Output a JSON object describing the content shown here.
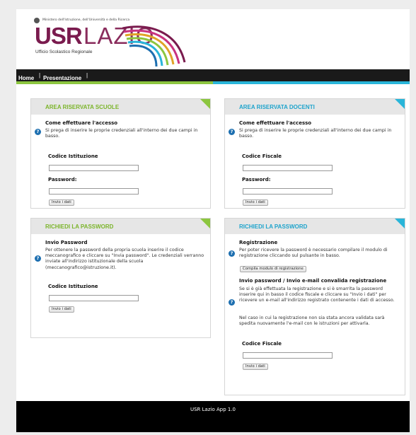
{
  "header": {
    "ministry": "Ministero dell'Istruzione, dell'Università e della Ricerca",
    "logo_bold": "USR",
    "logo_light": "LAZIO",
    "logo_sub": "Ufficio Scolastico Regionale"
  },
  "nav": {
    "items": [
      {
        "label": "Home"
      },
      {
        "label": "Presentazione"
      }
    ],
    "separator": "|"
  },
  "panels": {
    "scuole": {
      "title": "AREA RISERVATA SCUOLE",
      "heading": "Come effettuare l'accesso",
      "text": "Si prega di inserire le proprie credenziali all'interno dei due campi in basso.",
      "field1_label": "Codice Istituzione",
      "field1_value": "",
      "field2_label": "Password:",
      "field2_value": "",
      "submit": "Invio i dati"
    },
    "docenti": {
      "title": "AREA RISERVATA DOCENTI",
      "heading": "Come effettuare l'accesso",
      "text": "Si prega di inserire le proprie credenziali all'interno dei due campi in basso.",
      "field1_label": "Codice Fiscale",
      "field1_value": "",
      "field2_label": "Password:",
      "field2_value": "",
      "submit": "Invio i dati"
    },
    "pwd_scuole": {
      "title": "RICHIEDI LA PASSWORD",
      "heading": "Invio Password",
      "text": "Per ottenere la password della propria scuola inserire il codice meccanografico e cliccare su \"Invia password\". Le credenziali verranno inviate all'indirizzo istituzionale della scuola (meccanografico@istruzione.it).",
      "field_label": "Codice Istituzione",
      "field_value": "",
      "submit": "Invio i dati"
    },
    "pwd_docenti": {
      "title": "RICHIEDI LA PASSWORD",
      "heading": "Registrazione",
      "text": "Per poter ricevere la password è necessario compilare il modulo di registrazione cliccando sul pulsante in basso.",
      "register_button": "Compila modulo di registrazione",
      "heading2": "Invio password / Invio e-mail convalida registrazione",
      "text2": "Se si è già effettuata la registrazione e si è smarrita la password inserire qui in basso il codice fiscale e cliccare su \"Invio i dati\" per ricevere un e-mail all'indirizzo registrato contenente i dati di accesso.",
      "text3": "Nel caso in cui la registrazione non sia stata ancora validata sarà spedita nuovamente l'e-mail con le istruzioni per attivarla.",
      "field_label": "Codice Fiscale",
      "field_value": "",
      "submit": "Invio i dati"
    }
  },
  "footer": {
    "text": "USR Lazio App 1.0"
  },
  "icons": {
    "help": "question-icon"
  },
  "colors": {
    "accent_green": "#8cc63f",
    "accent_blue": "#29b5d9",
    "brand": "#7a1b4e",
    "nav_bg": "#1a1a1a",
    "footer_bg": "#000000"
  }
}
